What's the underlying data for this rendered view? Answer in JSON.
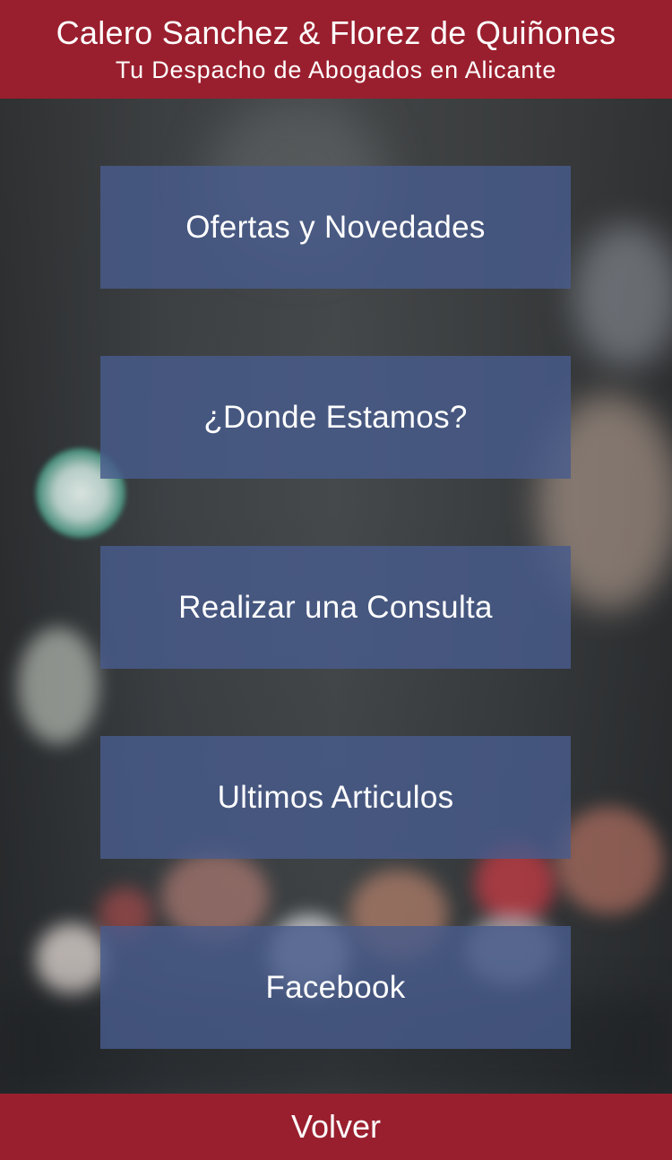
{
  "header": {
    "title": "Calero Sanchez & Florez de Quiñones",
    "subtitle": "Tu Despacho de Abogados en Alicante"
  },
  "menu": {
    "items": [
      {
        "label": "Ofertas y Novedades"
      },
      {
        "label": "¿Donde Estamos?"
      },
      {
        "label": "Realizar una Consulta"
      },
      {
        "label": "Ultimos Articulos"
      },
      {
        "label": "Facebook"
      }
    ]
  },
  "footer": {
    "back_label": "Volver"
  },
  "colors": {
    "header_bg": "#9a1f2e",
    "button_bg": "#485c8c",
    "text": "#ffffff"
  }
}
